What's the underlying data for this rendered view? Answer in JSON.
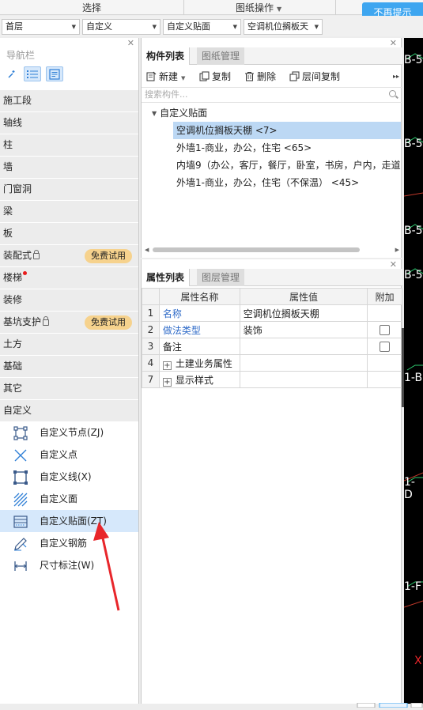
{
  "topbar": {
    "select_label": "选择",
    "drawing_ops_label": "图纸操作",
    "no_more_hint": "不再提示"
  },
  "dropdowns": {
    "floor": "首层",
    "category": "自定义",
    "type": "自定义贴面",
    "component": "空调机位搁板天"
  },
  "nav": {
    "title": "导航栏",
    "items": [
      {
        "label": "施工段"
      },
      {
        "label": "轴线"
      },
      {
        "label": "柱"
      },
      {
        "label": "墙"
      },
      {
        "label": "门窗洞"
      },
      {
        "label": "梁"
      },
      {
        "label": "板"
      },
      {
        "label": "装配式",
        "badge": "免费试用"
      },
      {
        "label": "楼梯"
      },
      {
        "label": "装修"
      },
      {
        "label": "基坑支护",
        "badge": "免费试用"
      },
      {
        "label": "土方"
      },
      {
        "label": "基础"
      },
      {
        "label": "其它"
      },
      {
        "label": "自定义"
      }
    ],
    "sub_items": [
      {
        "label": "自定义节点(ZJ)",
        "icon": "custom-node-icon"
      },
      {
        "label": "自定义点",
        "icon": "custom-point-icon"
      },
      {
        "label": "自定义线(X)",
        "icon": "custom-line-icon"
      },
      {
        "label": "自定义面",
        "icon": "custom-face-icon"
      },
      {
        "label": "自定义贴面(ZT)",
        "icon": "custom-veneer-icon"
      },
      {
        "label": "自定义钢筋",
        "icon": "custom-rebar-icon"
      },
      {
        "label": "尺寸标注(W)",
        "icon": "dimension-icon"
      }
    ]
  },
  "components": {
    "tabs": [
      "构件列表",
      "图纸管理"
    ],
    "toolbar": {
      "new": "新建",
      "copy": "复制",
      "delete": "删除",
      "floor_copy": "层间复制"
    },
    "search_placeholder": "搜索构件...",
    "tree_root": "自定义贴面",
    "tree_items": [
      "空调机位搁板天棚 <7>",
      "外墙1-商业，办公，住宅 <65>",
      "内墙9（办公，客厅，餐厅，卧室，书房，户内，走道",
      "外墙1-商业，办公，住宅（不保温） <45>"
    ]
  },
  "properties": {
    "tabs": [
      "属性列表",
      "图层管理"
    ],
    "headers": [
      "属性名称",
      "属性值",
      "附加"
    ],
    "rows": [
      {
        "num": "1",
        "name": "名称",
        "value": "空调机位搁板天棚"
      },
      {
        "num": "2",
        "name": "做法类型",
        "value": "装饰"
      },
      {
        "num": "3",
        "name": "备注",
        "value": ""
      },
      {
        "num": "4",
        "name": "土建业务属性",
        "value": ""
      },
      {
        "num": "7",
        "name": "显示样式",
        "value": ""
      }
    ]
  },
  "cad_labels": [
    "B-5",
    "B-5",
    "B-5",
    "B-5",
    "1-B",
    "1-D",
    "1-F",
    "X"
  ],
  "colors": {
    "accent": "#3ea6f0",
    "selection": "#bcd8f4",
    "badge": "#f6d28d",
    "arrow": "#e8262b"
  }
}
